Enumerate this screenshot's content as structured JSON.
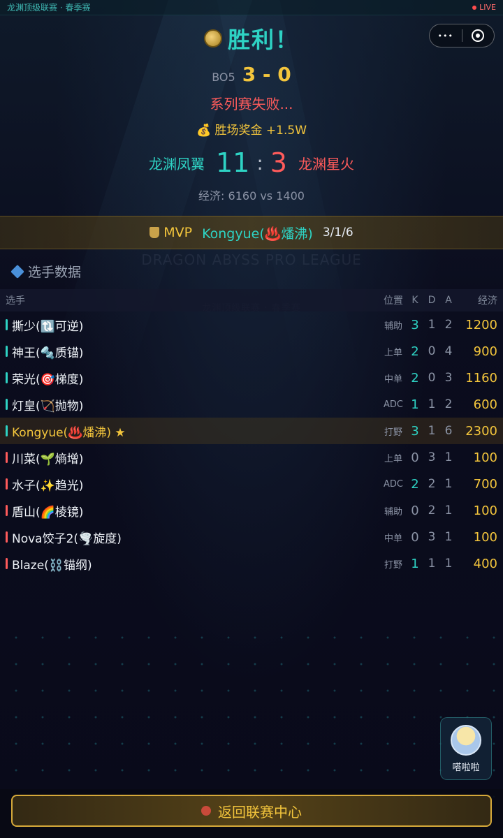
{
  "topbar": {
    "league": "龙渊顶级联赛 · 春季赛",
    "live": "LIVE"
  },
  "capsule": {
    "more": "•••"
  },
  "result": {
    "title": "胜利！",
    "format": "BO5",
    "series_score": "3 - 0",
    "status": "系列赛失败...",
    "prize": "💰 胜场奖金 +1.5W"
  },
  "match": {
    "team_a": "龙渊凤翼",
    "score_a": "11",
    "colon": ":",
    "score_b": "3",
    "team_b": "龙渊星火",
    "economy": "经济: 6160 vs 1400"
  },
  "mvp": {
    "label": "MVP",
    "name": "Kongyue(♨️燔沸)",
    "kda": "3/1/6"
  },
  "watermark": {
    "line1": "DRAGON ABYSS PRO LEAGUE",
    "line2": "龙渊顶级联赛 · 春季赛"
  },
  "stats": {
    "title": "选手数据",
    "headers": {
      "player": "选手",
      "pos": "位置",
      "k": "K",
      "d": "D",
      "a": "A",
      "gold": "经济"
    },
    "rows": [
      {
        "name": "撕少(🔃可逆)",
        "pos": "辅助",
        "k": "3",
        "d": "1",
        "a": "2",
        "gold": "1200"
      },
      {
        "name": "神王(🔩质锚)",
        "pos": "上单",
        "k": "2",
        "d": "0",
        "a": "4",
        "gold": "900"
      },
      {
        "name": "荣光(🎯梯度)",
        "pos": "中单",
        "k": "2",
        "d": "0",
        "a": "3",
        "gold": "1160"
      },
      {
        "name": "灯皇(🏹抛物)",
        "pos": "ADC",
        "k": "1",
        "d": "1",
        "a": "2",
        "gold": "600"
      },
      {
        "name": "Kongyue(♨️燔沸) ★",
        "pos": "打野",
        "k": "3",
        "d": "1",
        "a": "6",
        "gold": "2300"
      },
      {
        "name": "川菜(🌱熵增)",
        "pos": "上单",
        "k": "0",
        "d": "3",
        "a": "1",
        "gold": "100"
      },
      {
        "name": "水子(✨趋光)",
        "pos": "ADC",
        "k": "2",
        "d": "2",
        "a": "1",
        "gold": "700"
      },
      {
        "name": "盾山(🌈棱镜)",
        "pos": "辅助",
        "k": "0",
        "d": "2",
        "a": "1",
        "gold": "100"
      },
      {
        "name": "Nova饺子2(🌪️旋度)",
        "pos": "中单",
        "k": "0",
        "d": "3",
        "a": "1",
        "gold": "100"
      },
      {
        "name": "Blaze(⛓️锚纲)",
        "pos": "打野",
        "k": "1",
        "d": "1",
        "a": "1",
        "gold": "400"
      }
    ]
  },
  "assistant": {
    "label": "嗒啦啦"
  },
  "footer": {
    "back": "返回联赛中心"
  }
}
